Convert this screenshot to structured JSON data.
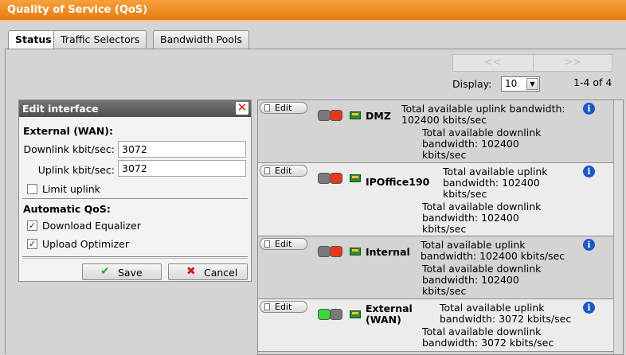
{
  "window": {
    "title": "Quality of Service (QoS)"
  },
  "tabs": [
    {
      "label": "Status",
      "active": true
    },
    {
      "label": "Traffic Selectors",
      "active": false
    },
    {
      "label": "Bandwidth Pools",
      "active": false
    }
  ],
  "pager": {
    "prev": "<<",
    "next": ">>",
    "display_label": "Display:",
    "display_value": "10",
    "range": "1-4 of 4"
  },
  "edit_panel": {
    "title": "Edit interface",
    "interface_name": "External (WAN):",
    "downlink_label": "Downlink kbit/sec:",
    "downlink_value": "3072",
    "uplink_label": "Uplink kbit/sec:",
    "uplink_value": "3072",
    "limit_uplink_label": "Limit uplink",
    "limit_uplink_checked": false,
    "auto_qos_label": "Automatic QoS:",
    "download_equalizer_label": "Download Equalizer",
    "download_equalizer_checked": true,
    "upload_optimizer_label": "Upload Optimizer",
    "upload_optimizer_checked": true,
    "save_label": "Save",
    "cancel_label": "Cancel"
  },
  "interfaces": [
    {
      "edit_label": "Edit",
      "name": "DMZ",
      "status": "down",
      "uplink_l1": "Total available uplink bandwidth:",
      "uplink_l2": "102400 kbits/sec",
      "downlink_l1": "Total available downlink",
      "downlink_l2": "bandwidth: 102400",
      "downlink_l3": "kbits/sec"
    },
    {
      "edit_label": "Edit",
      "name": "IPOffice190",
      "status": "down",
      "uplink_l1": "Total available uplink",
      "uplink_l2": "bandwidth: 102400",
      "uplink_l3": "kbits/sec",
      "downlink_l1": "Total available downlink",
      "downlink_l2": "bandwidth: 102400",
      "downlink_l3": "kbits/sec"
    },
    {
      "edit_label": "Edit",
      "name": "Internal",
      "status": "down",
      "uplink_l1": "Total available uplink",
      "uplink_l2": "bandwidth: 102400 kbits/sec",
      "downlink_l1": "Total available downlink",
      "downlink_l2": "bandwidth: 102400",
      "downlink_l3": "kbits/sec"
    },
    {
      "edit_label": "Edit",
      "name_l1": "External",
      "name_l2": "(WAN)",
      "status": "up",
      "uplink_l1": "Total available uplink",
      "uplink_l2": "bandwidth: 3072 kbits/sec",
      "downlink_l1": "Total available downlink",
      "downlink_l2": "bandwidth: 3072 kbits/sec"
    }
  ],
  "icons": {
    "info": "info-icon",
    "nic": "network-card-icon",
    "close": "close-icon",
    "save": "checkmark-icon",
    "cancel": "cross-icon"
  },
  "colors": {
    "title_bar": "#e57d10",
    "led_red": "#e53a1a",
    "led_green": "#3ad63a",
    "led_grey": "#7a7a7a",
    "info": "#1b57c8"
  }
}
